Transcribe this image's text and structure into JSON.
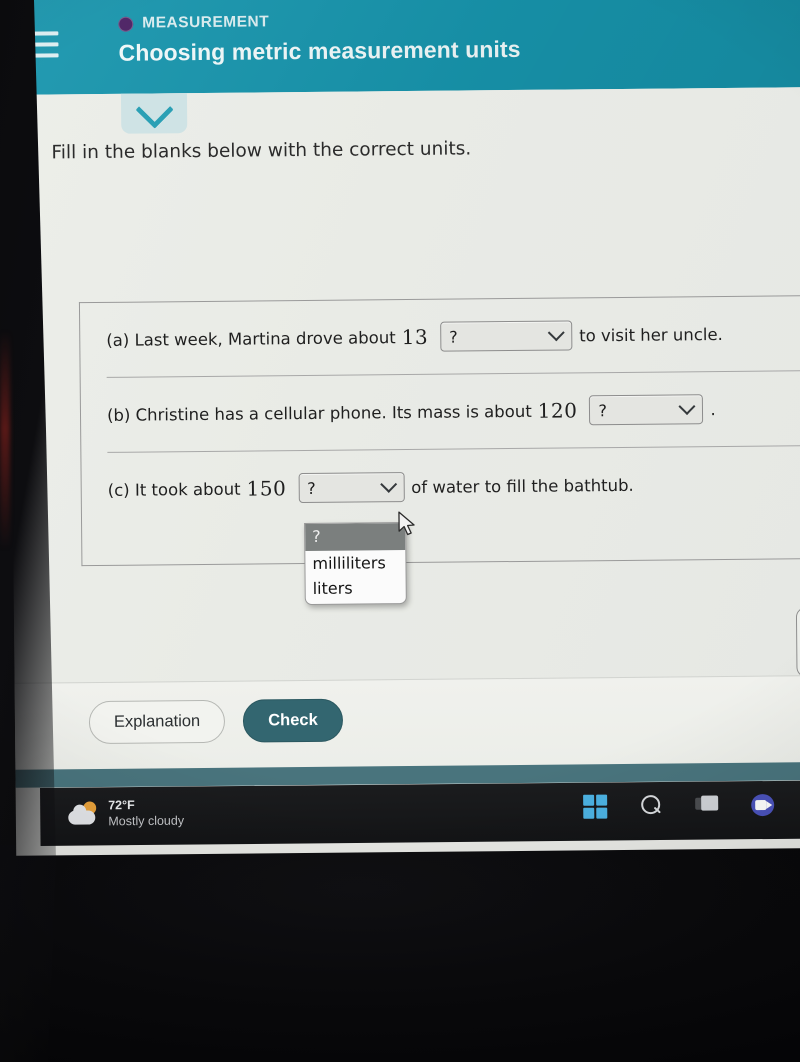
{
  "header": {
    "menu_icon": "hamburger-icon",
    "topic_icon": "purple-circle-icon",
    "topic_label": "MEASUREMENT",
    "title": "Choosing metric measurement units",
    "background_color": "#1795ad",
    "topic_dot_color": "#4a1f63"
  },
  "collapse_tab": {
    "icon": "chevron-down-icon"
  },
  "instruction": "Fill in the blanks below with the correct units.",
  "questions": [
    {
      "id": "a",
      "before": "(a) Last week, Martina drove about",
      "number": "13",
      "select_value": "?",
      "after": "to visit her uncle."
    },
    {
      "id": "b",
      "before": "(b) Christine has a cellular phone. Its mass is about",
      "number": "120",
      "select_value": "?",
      "after": "."
    },
    {
      "id": "c",
      "before": "(c) It took about",
      "number": "150",
      "select_value": "?",
      "after": "of water to fill the bathtub."
    }
  ],
  "dropdown": {
    "open_for": "c",
    "options": [
      "?",
      "milliliters",
      "liters"
    ],
    "highlighted": "?",
    "highlight_color": "#7b7f7e"
  },
  "footer": {
    "explanation_label": "Explanation",
    "check_label": "Check",
    "check_color": "#336670"
  },
  "taskbar": {
    "weather": {
      "icon": "sun-behind-cloud-icon",
      "temperature": "72°F",
      "condition": "Mostly cloudy"
    },
    "icons": [
      "windows-start-icon",
      "search-icon",
      "task-view-icon",
      "teams-icon",
      "edge-icon"
    ]
  },
  "cursor": {
    "icon": "arrow-pointer-icon"
  }
}
